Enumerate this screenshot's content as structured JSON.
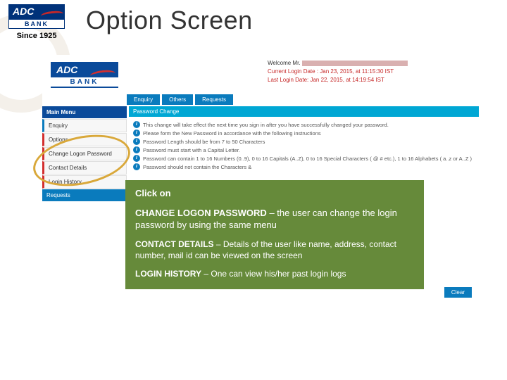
{
  "header": {
    "logo_text": "ADC",
    "logo_sub": "BANK",
    "since": "Since 1925",
    "title": "Option Screen"
  },
  "screenshot": {
    "logo_text": "ADC",
    "logo_sub": "BANK",
    "welcome_prefix": "Welcome Mr.",
    "current_login": "Current Login Date : Jan 23, 2015, at 11:15:30 IST",
    "last_login": "Last Login Date: Jan 22, 2015, at 14:19:54 IST",
    "nav": {
      "enquiry": "Enquiry",
      "others": "Others",
      "requests": "Requests"
    },
    "side": {
      "main_menu": "Main Menu",
      "enquiry": "Enquiry",
      "options": "Options",
      "change_pw": "Change Logon Password",
      "contact": "Contact Details",
      "login_history": "Login History",
      "requests": "Requests"
    },
    "panel_title": "Password Change",
    "rules": {
      "r1": "This change will take effect the next time you sign in after you have successfully changed your password.",
      "r2": "Please form the New Password in accordance with the following instructions",
      "r3": "Password Length should be from 7 to 50 Characters",
      "r4": "Password must start with a Capital Letter.",
      "r5": "Password can contain 1 to 16 Numbers (0..9), 0 to 16 Capitals (A..Z), 0 to 16 Special Characters ( @ # etc.), 1 to 16 Alphabets ( a..z or A..Z )",
      "r6": "Password should not contain the Characters &"
    },
    "clear_btn": "Clear"
  },
  "callout": {
    "click_on": "Click on",
    "cpw_label": "CHANGE LOGON PASSWORD",
    "cpw_sep": " – ",
    "cpw_text": "the user can change the login password by using the same menu",
    "contact_label": "CONTACT DETAILS",
    "contact_sep": " – ",
    "contact_text": "Details of the user like name, address, contact number, mail id can be viewed on the screen",
    "login_label": "LOGIN HISTORY",
    "login_sep": " – ",
    "login_text": "One can view his/her past login logs"
  }
}
